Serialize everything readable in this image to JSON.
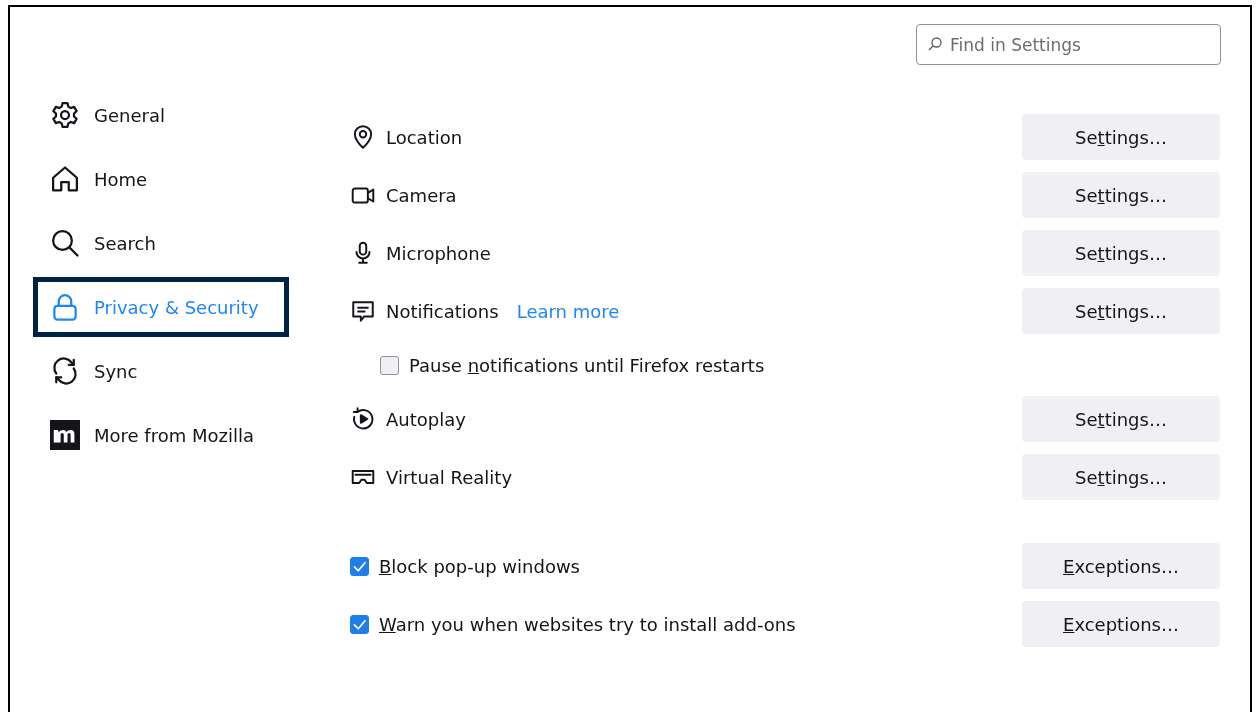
{
  "search": {
    "placeholder": "Find in Settings"
  },
  "sidebar": {
    "items": [
      {
        "label": "General",
        "selected": false
      },
      {
        "label": "Home",
        "selected": false
      },
      {
        "label": "Search",
        "selected": false
      },
      {
        "label": "Privacy & Security",
        "selected": true
      },
      {
        "label": "Sync",
        "selected": false
      },
      {
        "label": "More from Mozilla",
        "selected": false
      }
    ]
  },
  "permissions": [
    {
      "kind": "permission",
      "label": "Location",
      "button": {
        "pre": "Se",
        "key": "t",
        "post": "tings…"
      }
    },
    {
      "kind": "permission",
      "label": "Camera",
      "button": {
        "pre": "Se",
        "key": "t",
        "post": "tings…"
      }
    },
    {
      "kind": "permission",
      "label": "Microphone",
      "button": {
        "pre": "Se",
        "key": "t",
        "post": "tings…"
      }
    },
    {
      "kind": "permission",
      "label": "Notifications",
      "link": "Learn more",
      "button": {
        "pre": "Se",
        "key": "t",
        "post": "tings…"
      }
    },
    {
      "kind": "checkbox",
      "label": {
        "pre": "Pause ",
        "key": "n",
        "post": "otifications until Firefox restarts"
      },
      "checked": false
    },
    {
      "kind": "permission",
      "label": "Autoplay",
      "button": {
        "pre": "Se",
        "key": "t",
        "post": "tings…"
      }
    },
    {
      "kind": "permission",
      "label": "Virtual Reality",
      "button": {
        "pre": "Se",
        "key": "t",
        "post": "tings…"
      }
    }
  ],
  "blocking": [
    {
      "label": {
        "key": "B",
        "post": "lock pop-up windows"
      },
      "checked": true,
      "button": {
        "key": "E",
        "post": "xceptions…"
      }
    },
    {
      "label": {
        "key": "W",
        "post": "arn you when websites try to install add-ons"
      },
      "checked": true,
      "button": {
        "key": "E",
        "post": "xceptions…"
      }
    }
  ]
}
